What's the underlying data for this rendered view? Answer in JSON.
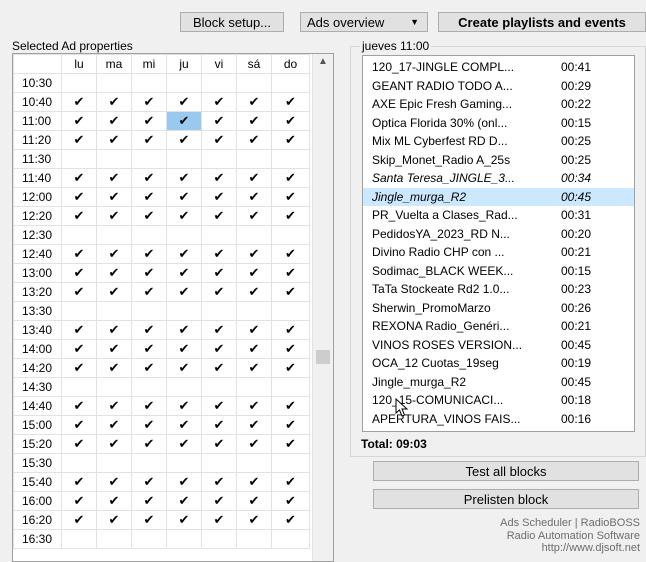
{
  "toolbar": {
    "block_setup": "Block setup...",
    "ads_overview": "Ads overview",
    "create_playlists": "Create playlists and events"
  },
  "grid": {
    "title": "Selected Ad properties",
    "days": [
      "lu",
      "ma",
      "mi",
      "ju",
      "vi",
      "sá",
      "do"
    ],
    "check_glyph": "✔",
    "scroll_up": "▲",
    "selected_cell": {
      "row": "11:00",
      "day": "ju"
    },
    "rows": [
      {
        "time": "10:30",
        "checked": false
      },
      {
        "time": "10:40",
        "checked": true
      },
      {
        "time": "11:00",
        "checked": true
      },
      {
        "time": "11:20",
        "checked": true
      },
      {
        "time": "11:30",
        "checked": false
      },
      {
        "time": "11:40",
        "checked": true
      },
      {
        "time": "12:00",
        "checked": true
      },
      {
        "time": "12:20",
        "checked": true
      },
      {
        "time": "12:30",
        "checked": false
      },
      {
        "time": "12:40",
        "checked": true
      },
      {
        "time": "13:00",
        "checked": true
      },
      {
        "time": "13:20",
        "checked": true
      },
      {
        "time": "13:30",
        "checked": false
      },
      {
        "time": "13:40",
        "checked": true
      },
      {
        "time": "14:00",
        "checked": true
      },
      {
        "time": "14:20",
        "checked": true
      },
      {
        "time": "14:30",
        "checked": false
      },
      {
        "time": "14:40",
        "checked": true
      },
      {
        "time": "15:00",
        "checked": true
      },
      {
        "time": "15:20",
        "checked": true
      },
      {
        "time": "15:30",
        "checked": false
      },
      {
        "time": "15:40",
        "checked": true
      },
      {
        "time": "16:00",
        "checked": true
      },
      {
        "time": "16:20",
        "checked": true
      },
      {
        "time": "16:30",
        "checked": false
      }
    ]
  },
  "block": {
    "title": "jueves 11:00",
    "items": [
      {
        "name": "120_17-JINGLE COMPL...",
        "dur": "00:41",
        "italic": false,
        "selected": false
      },
      {
        "name": "GEANT RADIO TODO A...",
        "dur": "00:29",
        "italic": false,
        "selected": false
      },
      {
        "name": "AXE Epic Fresh Gaming...",
        "dur": "00:22",
        "italic": false,
        "selected": false
      },
      {
        "name": "Optica Florida 30% (onl...",
        "dur": "00:15",
        "italic": false,
        "selected": false
      },
      {
        "name": "Mix ML Cyberfest RD D...",
        "dur": "00:25",
        "italic": false,
        "selected": false
      },
      {
        "name": "Skip_Monet_Radio A_25s",
        "dur": "00:25",
        "italic": false,
        "selected": false
      },
      {
        "name": "Santa Teresa_JINGLE_3...",
        "dur": "00:34",
        "italic": true,
        "selected": false
      },
      {
        "name": "Jingle_murga_R2",
        "dur": "00:45",
        "italic": true,
        "selected": true
      },
      {
        "name": "PR_Vuelta a Clases_Rad...",
        "dur": "00:31",
        "italic": false,
        "selected": false
      },
      {
        "name": "PedidosYA_2023_RD N...",
        "dur": "00:20",
        "italic": false,
        "selected": false
      },
      {
        "name": "Divino Radio CHP con ...",
        "dur": "00:21",
        "italic": false,
        "selected": false
      },
      {
        "name": "Sodimac_BLACK WEEK...",
        "dur": "00:15",
        "italic": false,
        "selected": false
      },
      {
        "name": "TaTa Stockeate Rd2 1.0...",
        "dur": "00:23",
        "italic": false,
        "selected": false
      },
      {
        "name": "Sherwin_PromoMarzo",
        "dur": "00:26",
        "italic": false,
        "selected": false
      },
      {
        "name": " REXONA Radio_Genéri...",
        "dur": "00:21",
        "italic": false,
        "selected": false
      },
      {
        "name": "VINOS ROSES VERSION...",
        "dur": "00:45",
        "italic": false,
        "selected": false
      },
      {
        "name": "OCA_12 Cuotas_19seg",
        "dur": "00:19",
        "italic": false,
        "selected": false
      },
      {
        "name": "Jingle_murga_R2",
        "dur": "00:45",
        "italic": false,
        "selected": false
      },
      {
        "name": "120_15-COMUNICACI...",
        "dur": "00:18",
        "italic": false,
        "selected": false
      },
      {
        "name": "APERTURA_VINOS FAIS...",
        "dur": "00:16",
        "italic": false,
        "selected": false
      }
    ],
    "total": "Total: 09:03",
    "test_all": "Test all blocks",
    "prelisten": "Prelisten block"
  },
  "footer": {
    "line1": "Ads Scheduler | RadioBOSS",
    "line2": "Radio Automation Software",
    "line3": "http://www.djsoft.net"
  },
  "colors": {
    "selection_cell": "#99c9ef",
    "selection_row": "#cce8ff",
    "footer_text": "#6d6d6d"
  }
}
